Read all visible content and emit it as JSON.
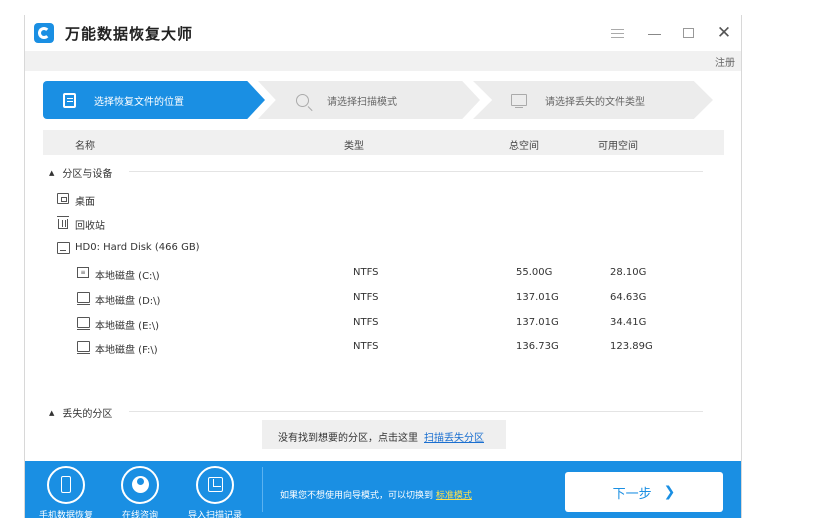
{
  "app": {
    "title": "万能数据恢复大师",
    "register": "注册"
  },
  "steps": [
    {
      "label": "选择恢复文件的位置",
      "icon": "document-icon",
      "active": true
    },
    {
      "label": "请选择扫描模式",
      "icon": "search-icon",
      "active": false
    },
    {
      "label": "请选择丢失的文件类型",
      "icon": "monitor-icon",
      "active": false
    }
  ],
  "columns": {
    "name": "名称",
    "type": "类型",
    "total": "总空间",
    "free": "可用空间"
  },
  "groups": {
    "partitions": "分区与设备",
    "lost": "丢失的分区"
  },
  "items": {
    "desktop": "桌面",
    "recycle": "回收站",
    "disk": "HD0: Hard Disk (466 GB)"
  },
  "drives": [
    {
      "name": "本地磁盘 (C:\\)",
      "type": "NTFS",
      "total": "55.00G",
      "free": "28.10G",
      "icon": "system-drive-icon"
    },
    {
      "name": "本地磁盘 (D:\\)",
      "type": "NTFS",
      "total": "137.01G",
      "free": "64.63G",
      "icon": "drive-icon"
    },
    {
      "name": "本地磁盘 (E:\\)",
      "type": "NTFS",
      "total": "137.01G",
      "free": "34.41G",
      "icon": "drive-icon"
    },
    {
      "name": "本地磁盘 (F:\\)",
      "type": "NTFS",
      "total": "136.73G",
      "free": "123.89G",
      "icon": "drive-icon"
    }
  ],
  "hint": {
    "text": "没有找到想要的分区，点击这里",
    "link": "扫描丢失分区"
  },
  "footer": {
    "buttons": [
      "手机数据恢复",
      "在线咨询",
      "导入扫描记录"
    ],
    "text": "如果您不想使用向导模式，可以切换到",
    "link": "标准模式",
    "next": "下一步"
  },
  "colors": {
    "accent": "#1a8fe3",
    "link": "#1a6fd0",
    "footer_link": "#ffe14d"
  }
}
